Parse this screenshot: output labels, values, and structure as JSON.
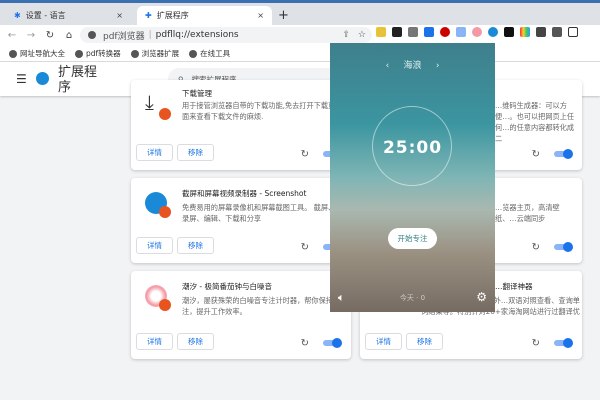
{
  "tabs": [
    {
      "label": "设置 - 语言",
      "icon": "gear-icon"
    },
    {
      "label": "扩展程序",
      "icon": "puzzle-icon",
      "active": true
    }
  ],
  "new_tab": "+",
  "close": "×",
  "omnibox": {
    "site": "pdf浏览器",
    "url": "pdfllq://extensions"
  },
  "bookmarks": [
    "网址导航大全",
    "pdf转换器",
    "浏览器扩展",
    "在线工具"
  ],
  "header": {
    "title": "扩展程序",
    "search_placeholder": "搜索扩展程序"
  },
  "buttons": {
    "details": "详情",
    "remove": "移除"
  },
  "cards": [
    {
      "name": "下载管理",
      "desc": "用于接管浏览器自带的下载功能,免去打开下载页面来查看下载文件的麻烦.",
      "color": "#333"
    },
    {
      "name": "截屏和屏幕视频录制器 - Screenshot",
      "desc": "免费易用的屏幕录像机和屏幕截图工具。 截屏、录屏、编辑、下载和分享",
      "color": "#1a8ad8"
    },
    {
      "name": "潮汐 - 极简番茄钟与白噪音",
      "desc": "潮汐，屡获殊荣的白噪音专注计时器，帮你保持专注，提升工作效率。",
      "color": "#f49aa5"
    },
    {
      "name": "",
      "desc": "…维码生成器：可以方便…。也可以把网页上任何…的任意内容都转化成二"
    },
    {
      "name": "",
      "desc": "…览器主页，高清壁纸、…云端同步"
    },
    {
      "name": "…翻译神器",
      "desc": "…多种语言的翻译，浏览外…双语对照查看、查询单词结果等。特别针对20+家海淘网站进行过翻译优"
    }
  ],
  "popup": {
    "scene": "海浪",
    "prev": "‹",
    "next": "›",
    "timer": "25:00",
    "start": "开始专注",
    "today": "今天 · 0"
  }
}
